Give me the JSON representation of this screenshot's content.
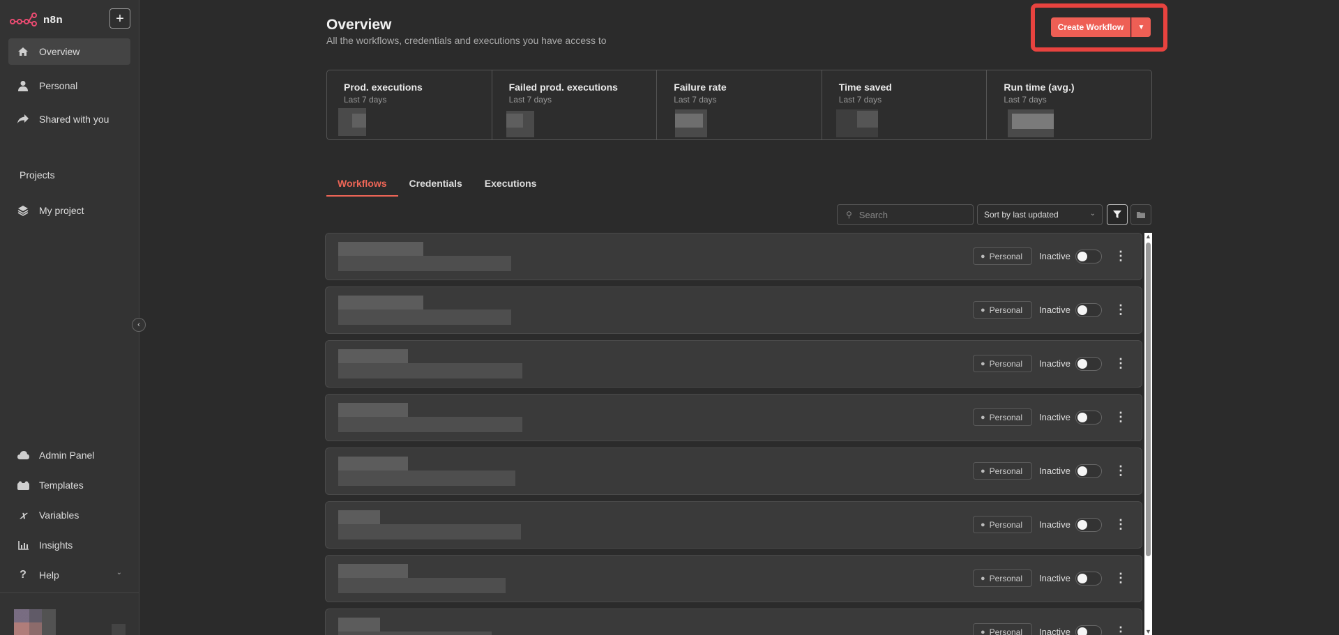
{
  "app": {
    "logo_text": "n8n",
    "add_label": "+"
  },
  "sidebar": {
    "items": [
      {
        "label": "Overview",
        "icon": "home-icon"
      },
      {
        "label": "Personal",
        "icon": "user-icon"
      },
      {
        "label": "Shared with you",
        "icon": "share-icon"
      }
    ],
    "projects_label": "Projects",
    "project_items": [
      {
        "label": "My project",
        "icon": "layers-icon"
      }
    ],
    "bottom_items": [
      {
        "label": "Admin Panel",
        "icon": "cloud-icon"
      },
      {
        "label": "Templates",
        "icon": "templates-icon"
      },
      {
        "label": "Variables",
        "icon": "variable-icon"
      },
      {
        "label": "Insights",
        "icon": "chart-icon"
      },
      {
        "label": "Help",
        "icon": "help-icon"
      }
    ]
  },
  "header": {
    "title": "Overview",
    "subtitle": "All the workflows, credentials and executions you have access to",
    "create_label": "Create Workflow"
  },
  "stats": [
    {
      "title": "Prod. executions",
      "sub": "Last 7 days"
    },
    {
      "title": "Failed prod. executions",
      "sub": "Last 7 days"
    },
    {
      "title": "Failure rate",
      "sub": "Last 7 days"
    },
    {
      "title": "Time saved",
      "sub": "Last 7 days"
    },
    {
      "title": "Run time (avg.)",
      "sub": "Last 7 days"
    }
  ],
  "tabs": [
    {
      "label": "Workflows"
    },
    {
      "label": "Credentials"
    },
    {
      "label": "Executions"
    }
  ],
  "toolbar": {
    "search_placeholder": "Search",
    "sort_label": "Sort by last updated"
  },
  "workflows": [
    {
      "owner": "Personal",
      "status": "Inactive"
    },
    {
      "owner": "Personal",
      "status": "Inactive"
    },
    {
      "owner": "Personal",
      "status": "Inactive"
    },
    {
      "owner": "Personal",
      "status": "Inactive"
    },
    {
      "owner": "Personal",
      "status": "Inactive"
    },
    {
      "owner": "Personal",
      "status": "Inactive"
    },
    {
      "owner": "Personal",
      "status": "Inactive"
    },
    {
      "owner": "Personal",
      "status": "Inactive"
    }
  ],
  "colors": {
    "accent": "#ee5f55",
    "highlight": "#e8433f",
    "background": "#2b2b2b",
    "sidebar": "#333333"
  }
}
